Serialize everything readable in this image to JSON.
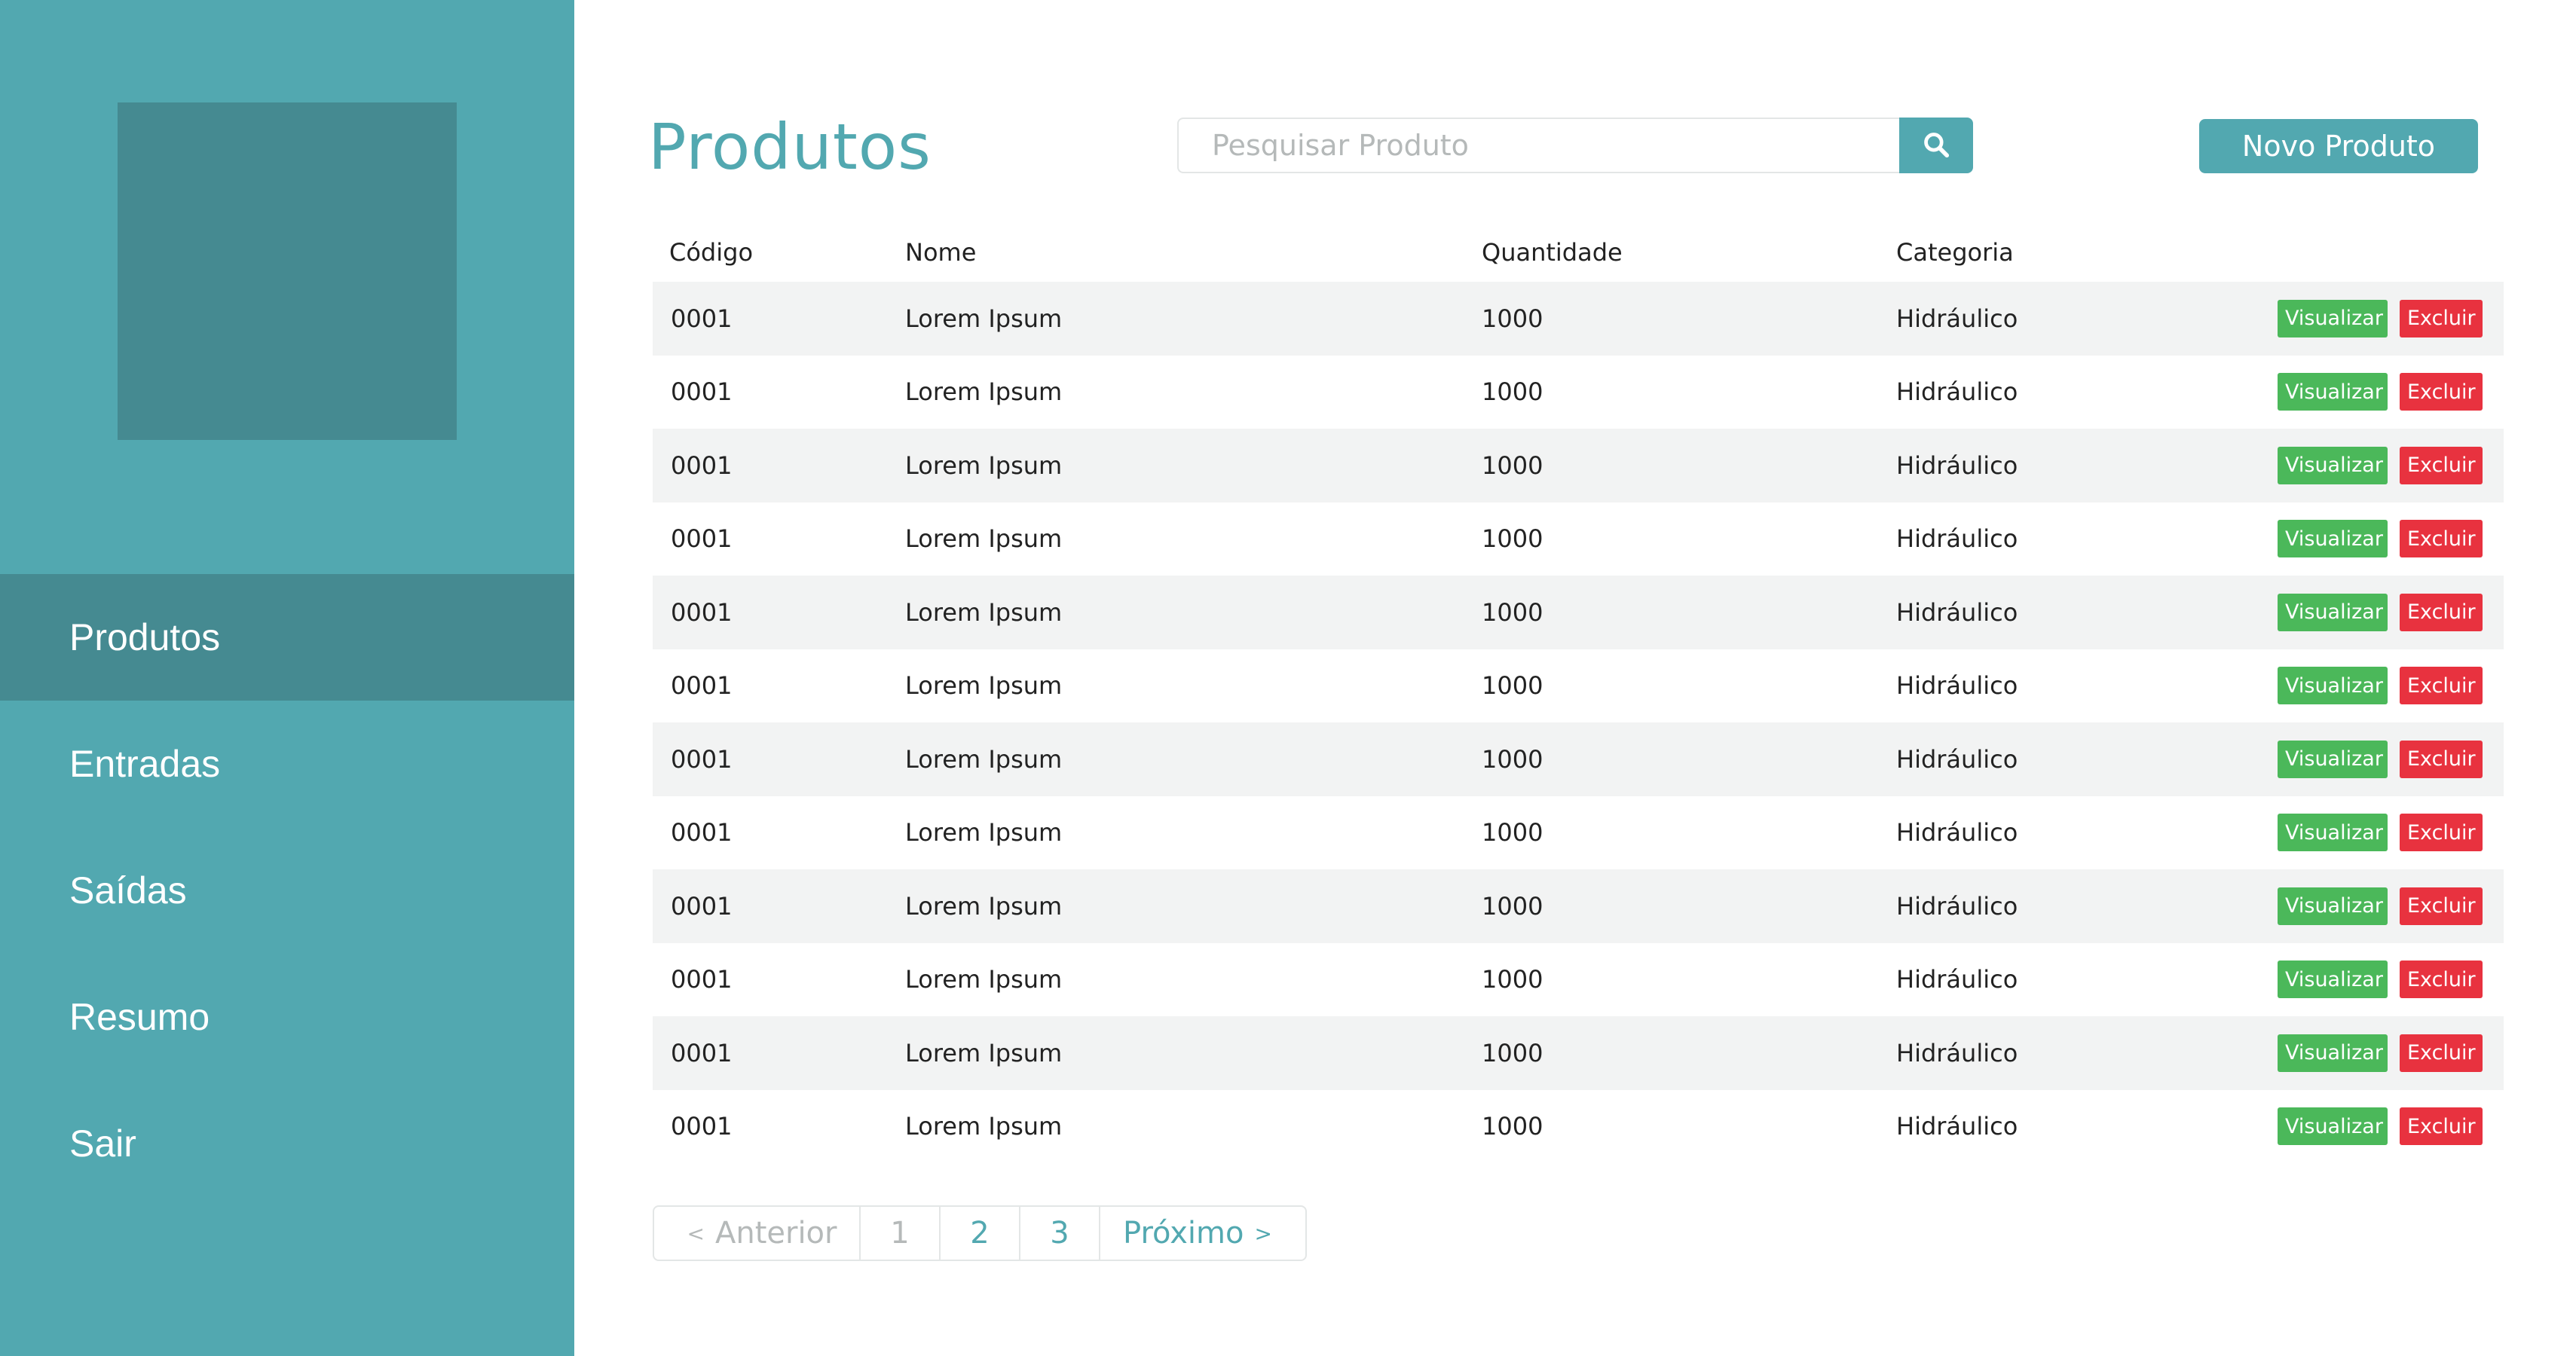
{
  "sidebar": {
    "items": [
      {
        "label": "Produtos",
        "active": true
      },
      {
        "label": "Entradas",
        "active": false
      },
      {
        "label": "Saídas",
        "active": false
      },
      {
        "label": "Resumo",
        "active": false
      },
      {
        "label": "Sair",
        "active": false
      }
    ]
  },
  "header": {
    "title": "Produtos",
    "search_placeholder": "Pesquisar Produto",
    "search_icon": "search-icon",
    "new_button_label": "Novo Produto"
  },
  "table": {
    "columns": [
      "Código",
      "Nome",
      "Quantidade",
      "Categoria"
    ],
    "rows": [
      {
        "code": "0001",
        "name": "Lorem Ipsum",
        "qty": "1000",
        "category": "Hidráulico"
      },
      {
        "code": "0001",
        "name": "Lorem Ipsum",
        "qty": "1000",
        "category": "Hidráulico"
      },
      {
        "code": "0001",
        "name": "Lorem Ipsum",
        "qty": "1000",
        "category": "Hidráulico"
      },
      {
        "code": "0001",
        "name": "Lorem Ipsum",
        "qty": "1000",
        "category": "Hidráulico"
      },
      {
        "code": "0001",
        "name": "Lorem Ipsum",
        "qty": "1000",
        "category": "Hidráulico"
      },
      {
        "code": "0001",
        "name": "Lorem Ipsum",
        "qty": "1000",
        "category": "Hidráulico"
      },
      {
        "code": "0001",
        "name": "Lorem Ipsum",
        "qty": "1000",
        "category": "Hidráulico"
      },
      {
        "code": "0001",
        "name": "Lorem Ipsum",
        "qty": "1000",
        "category": "Hidráulico"
      },
      {
        "code": "0001",
        "name": "Lorem Ipsum",
        "qty": "1000",
        "category": "Hidráulico"
      },
      {
        "code": "0001",
        "name": "Lorem Ipsum",
        "qty": "1000",
        "category": "Hidráulico"
      },
      {
        "code": "0001",
        "name": "Lorem Ipsum",
        "qty": "1000",
        "category": "Hidráulico"
      },
      {
        "code": "0001",
        "name": "Lorem Ipsum",
        "qty": "1000",
        "category": "Hidráulico"
      }
    ],
    "view_label": "Visualizar",
    "delete_label": "Excluir"
  },
  "pagination": {
    "prev_label": "Anterior",
    "pages": [
      "1",
      "2",
      "3"
    ],
    "current_page": "1",
    "next_label": "Próximo"
  },
  "colors": {
    "accent": "#52a8b0",
    "accent_dark": "#458a91",
    "view_button": "#4bb85a",
    "delete_button": "#e8323f"
  }
}
